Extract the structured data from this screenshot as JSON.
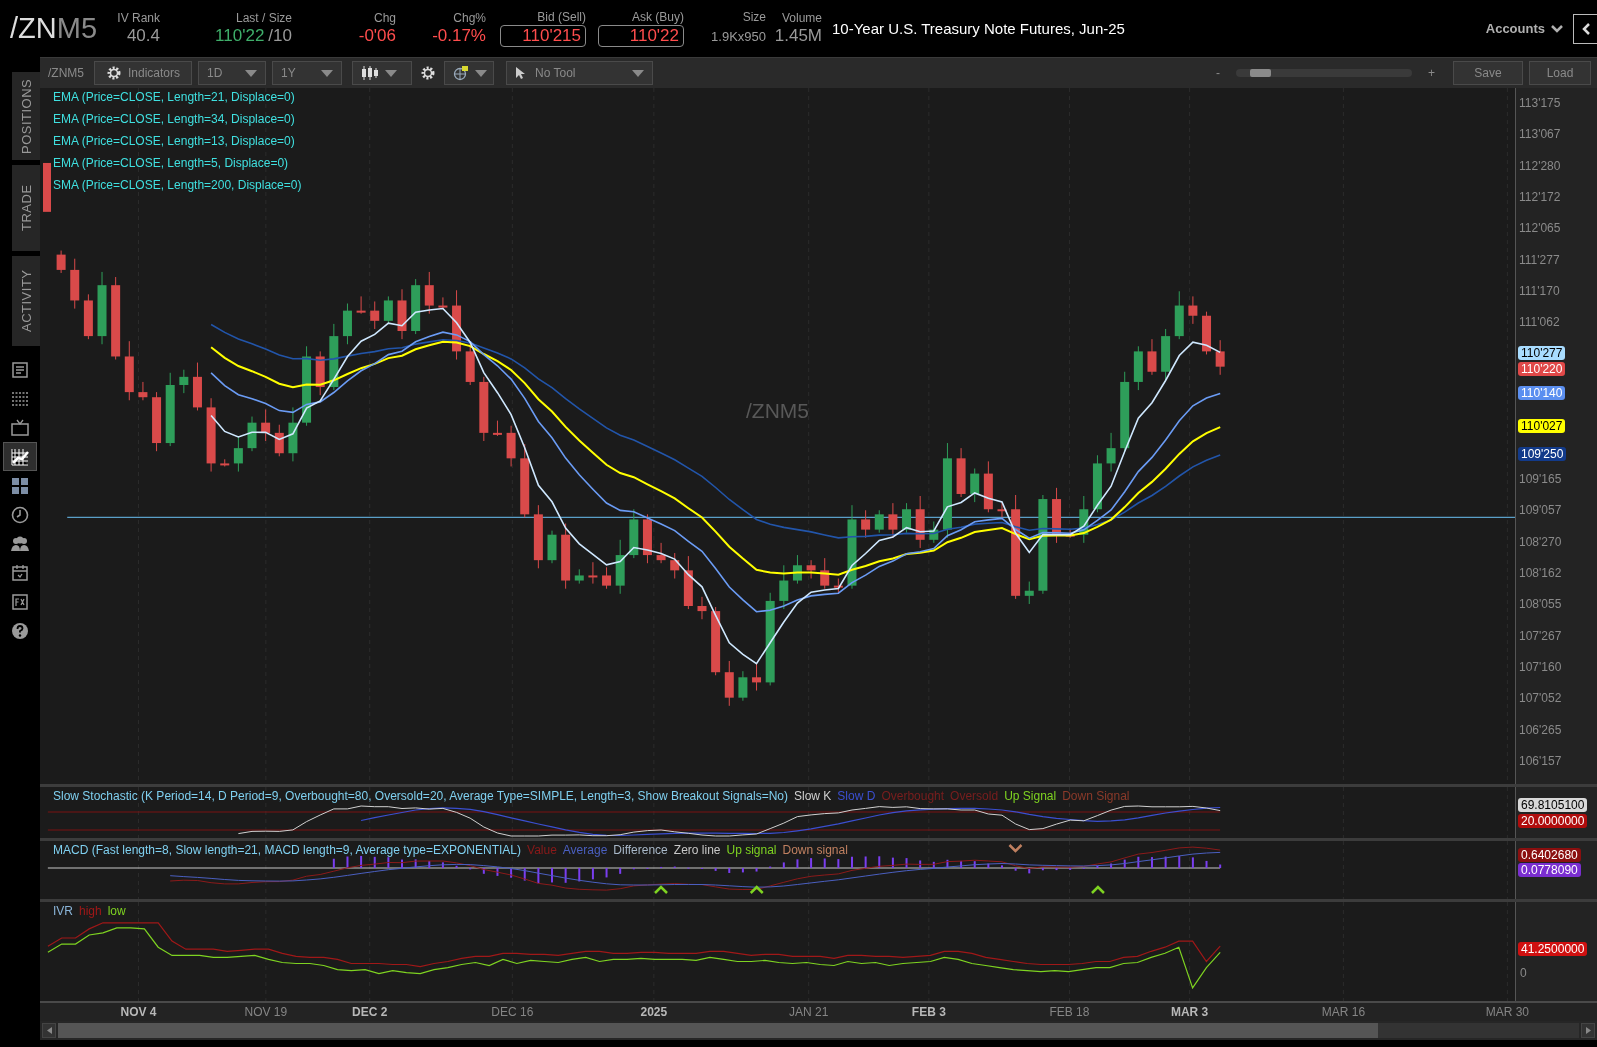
{
  "header": {
    "symbol": {
      "root": "/ZN",
      "month": "M5"
    },
    "stats": [
      {
        "label": "IV Rank",
        "value": "40.4",
        "color": "#9a9a9a",
        "kind": "plain"
      },
      {
        "label": "Last / Size",
        "value": "110'22",
        "extra": "/10",
        "color": "#3fae6a",
        "kind": "plain"
      },
      {
        "label": "Chg",
        "value": "-0'06",
        "color": "#ff4d4d",
        "kind": "plain"
      },
      {
        "label": "Chg%",
        "value": "-0.17%",
        "color": "#ff4d4d",
        "kind": "plain"
      },
      {
        "label": "Bid (Sell)",
        "value": "110'215",
        "color": "#ff4d4d",
        "kind": "boxed"
      },
      {
        "label": "Ask (Buy)",
        "value": "110'22",
        "color": "#ff4d4d",
        "kind": "boxed"
      },
      {
        "label": "Size",
        "value": "1.9Kx950",
        "color": "#9a9a9a",
        "kind": "compact"
      },
      {
        "label": "Volume",
        "value": "1.45M",
        "color": "#9a9a9a",
        "kind": "plain"
      }
    ],
    "description": "10-Year U.S. Treasury Note Futures, Jun-25",
    "accounts": "Accounts"
  },
  "sidebar": {
    "tabs": [
      {
        "label": "POSITIONS"
      },
      {
        "label": "TRADE"
      },
      {
        "label": "ACTIVITY"
      }
    ],
    "icons": [
      {
        "kind": "news",
        "selected": false
      },
      {
        "kind": "list",
        "selected": false
      },
      {
        "kind": "tv",
        "selected": false
      },
      {
        "kind": "chart",
        "selected": true
      },
      {
        "kind": "grid",
        "selected": false
      },
      {
        "kind": "clock",
        "selected": false
      },
      {
        "kind": "people",
        "selected": false
      },
      {
        "kind": "calendar",
        "selected": false
      },
      {
        "kind": "fx",
        "selected": false
      },
      {
        "kind": "help",
        "selected": false
      }
    ]
  },
  "toolbar": {
    "symbol": "/ZNM5",
    "indicators": "Indicators",
    "aggregation": "1D",
    "period": "1Y",
    "drawing_tool": "No Tool",
    "zoom": {
      "minus": "-",
      "plus": "+",
      "level": 0.09
    },
    "buttons": [
      "Save",
      "Load"
    ]
  },
  "price_pane": {
    "legend": [
      "EMA (Price=CLOSE, Length=21, Displace=0)",
      "EMA (Price=CLOSE, Length=34, Displace=0)",
      "EMA (Price=CLOSE, Length=13, Displace=0)",
      "EMA (Price=CLOSE, Length=5, Displace=0)",
      "SMA (Price=CLOSE, Length=200, Displace=0)"
    ],
    "watermark": "/ZNM5",
    "axis_ticks": [
      "113'175",
      "113'067",
      "112'280",
      "112'172",
      "112'065",
      "111'277",
      "111'170",
      "111'062",
      "109'165",
      "109'057",
      "108'270",
      "108'162",
      "108'055",
      "107'267",
      "107'160",
      "107'052",
      "106'265",
      "106'157"
    ],
    "badges": [
      {
        "text": "110'277",
        "color": "#a8dcff"
      },
      {
        "text": "110'220",
        "color": "#e04848"
      },
      {
        "text": "110'140",
        "color": "#5b8ff0"
      },
      {
        "text": "110'027",
        "color": "#ffff00"
      },
      {
        "text": "109'250",
        "color": "#123a8a"
      }
    ]
  },
  "studies": [
    {
      "kind": "stochastic",
      "title": "Slow Stochastic (K Period=14, D Period=9, Overbought=80, Oversold=20, Average Type=SIMPLE, Length=3, Show Breakout Signals=No)",
      "legend": [
        {
          "label": "Slow K",
          "color": "#d0d0d0"
        },
        {
          "label": "Slow D",
          "color": "#3b4fd0"
        },
        {
          "label": "Overbought",
          "color": "#7a1e1e"
        },
        {
          "label": "Oversold",
          "color": "#7a1e1e"
        },
        {
          "label": "Up Signal",
          "color": "#7ed321"
        },
        {
          "label": "Down Signal",
          "color": "#8b3a2a"
        }
      ],
      "badges": [
        {
          "text": "69.8105100",
          "color": "#d8d8d8"
        },
        {
          "text": "20.0000000",
          "color": "#b00c0c"
        }
      ]
    },
    {
      "kind": "macd",
      "title": "MACD (Fast length=8, Slow length=21, MACD length=9, Average type=EXPONENTIAL)",
      "legend": [
        {
          "label": "Value",
          "color": "#8b1a1a"
        },
        {
          "label": "Average",
          "color": "#4a5fc0"
        },
        {
          "label": "Difference",
          "color": "#a8b8c8"
        },
        {
          "label": "Zero line",
          "color": "#c8c8c8"
        },
        {
          "label": "Up signal",
          "color": "#7ed321"
        },
        {
          "label": "Down signal",
          "color": "#c08060"
        }
      ],
      "badges": [
        {
          "text": "0.6402680",
          "color": "#8b0f0f"
        },
        {
          "text": "0.0778090",
          "color": "#7a2ed0"
        }
      ]
    },
    {
      "kind": "ivr",
      "title": "IVR",
      "legend": [
        {
          "label": "high",
          "color": "#a01818"
        },
        {
          "label": "low",
          "color": "#7ed321"
        }
      ],
      "badges": [
        {
          "text": "41.2500000",
          "color": "#d01010"
        }
      ],
      "axis_label": "0"
    }
  ],
  "time_axis": [
    {
      "label": "NOV 4",
      "major": true
    },
    {
      "label": "NOV 19",
      "major": false
    },
    {
      "label": "DEC 2",
      "major": true
    },
    {
      "label": "DEC 16",
      "major": false
    },
    {
      "label": "2025",
      "major": true
    },
    {
      "label": "JAN 21",
      "major": false
    },
    {
      "label": "FEB 3",
      "major": true
    },
    {
      "label": "FEB 18",
      "major": false
    },
    {
      "label": "MAR 3",
      "major": true
    },
    {
      "label": "MAR 16",
      "major": false
    },
    {
      "label": "MAR 30",
      "major": false
    }
  ]
}
